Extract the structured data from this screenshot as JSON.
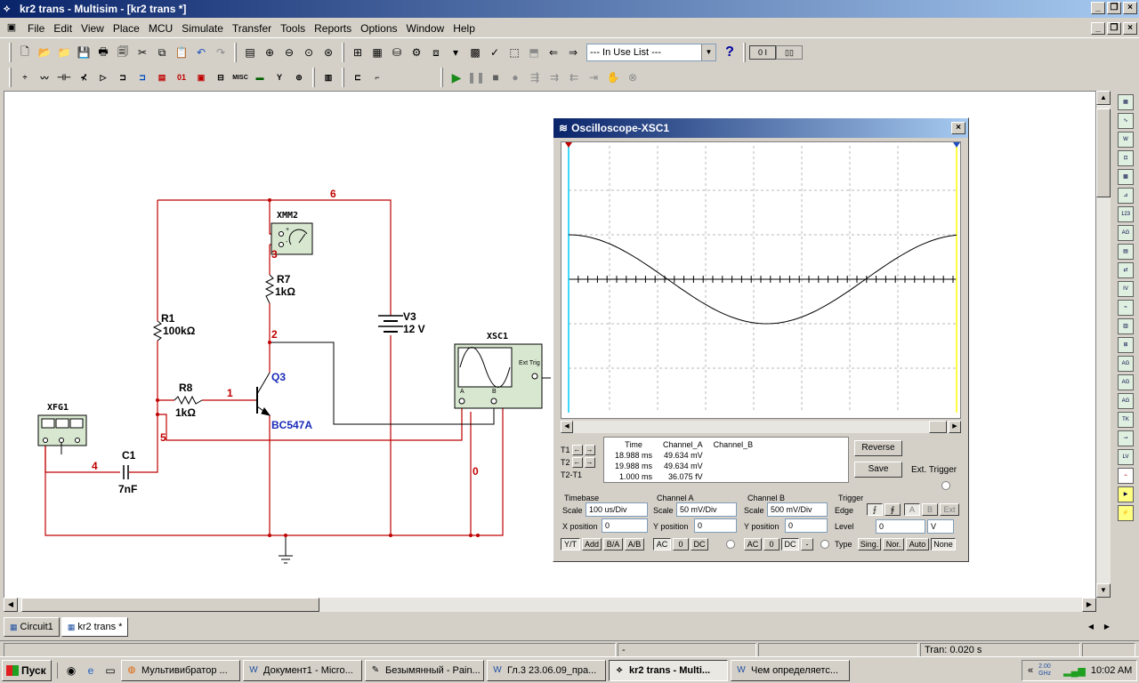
{
  "app": {
    "title": "kr2 trans - Multisim - [kr2 trans *]"
  },
  "menu": [
    "File",
    "Edit",
    "View",
    "Place",
    "MCU",
    "Simulate",
    "Transfer",
    "Tools",
    "Reports",
    "Options",
    "Window",
    "Help"
  ],
  "toolbar": {
    "in_use_list": "--- In Use List ---",
    "misc_label": "MISC"
  },
  "circuit": {
    "components": {
      "r1_name": "R1",
      "r1_value": "100kΩ",
      "r7_name": "R7",
      "r7_value": "1kΩ",
      "r8_name": "R8",
      "r8_value": "1kΩ",
      "c1_name": "C1",
      "c1_value": "7nF",
      "v3_name": "V3",
      "v3_value": "12 V",
      "q3_name": "Q3",
      "q3_model": "BC547A",
      "xmm2": "XMM2",
      "xfg1": "XFG1",
      "xsc1": "XSC1",
      "ext_trig": "Ext Trig",
      "xmm_plus": "+",
      "xmm_minus": "-",
      "xsc_a": "A",
      "xsc_b": "B"
    },
    "nets": [
      "6",
      "3",
      "2",
      "1",
      "5",
      "4",
      "0"
    ]
  },
  "oscilloscope": {
    "title": "Oscilloscope-XSC1",
    "labels": {
      "t1": "T1",
      "t2": "T2",
      "t21": "T2-T1"
    },
    "table": {
      "headers": [
        "Time",
        "Channel_A",
        "Channel_B"
      ],
      "rows": [
        [
          "18.988 ms",
          "49.634 mV",
          ""
        ],
        [
          "19.988 ms",
          "49.634 mV",
          ""
        ],
        [
          "1.000 ms",
          "36.075 fV",
          ""
        ]
      ]
    },
    "buttons": {
      "reverse": "Reverse",
      "save": "Save",
      "ext_trigger": "Ext. Trigger"
    },
    "timebase": {
      "title": "Timebase",
      "scale_label": "Scale",
      "scale": "100 us/Div",
      "xpos_label": "X position",
      "xpos": "0",
      "modes": [
        "Y/T",
        "Add",
        "B/A",
        "A/B"
      ]
    },
    "channel_a": {
      "title": "Channel A",
      "scale_label": "Scale",
      "scale": "50 mV/Div",
      "ypos_label": "Y position",
      "ypos": "0",
      "coupling": [
        "AC",
        "0",
        "DC"
      ]
    },
    "channel_b": {
      "title": "Channel B",
      "scale_label": "Scale",
      "scale": "500 mV/Div",
      "ypos_label": "Y position",
      "ypos": "0",
      "coupling": [
        "AC",
        "0",
        "DC",
        "-"
      ]
    },
    "trigger": {
      "title": "Trigger",
      "edge_label": "Edge",
      "edge_sources": [
        "A",
        "B",
        "Ext"
      ],
      "level_label": "Level",
      "level": "0",
      "level_unit": "V",
      "type_label": "Type",
      "types": [
        "Sing.",
        "Nor.",
        "Auto",
        "None"
      ]
    }
  },
  "tabs": [
    "Circuit1",
    "kr2 trans *"
  ],
  "status": {
    "transient": "Tran: 0.020 s",
    "dash": "-"
  },
  "taskbar": {
    "start": "Пуск",
    "tasks": [
      "Мультивибратор ...",
      "Документ1 - Micro...",
      "Безымянный - Pain...",
      "Гл.3 23.06.09_пра...",
      "kr2 trans - Multi...",
      "Чем определяетс..."
    ],
    "active_index": 4,
    "tray_arrow": "«",
    "cpu": "2.00 GHz",
    "clock": "10:02 AM"
  },
  "colors": {
    "wire": "#c00000",
    "net_label": "#c00000",
    "transistor_label": "#1a2ab8",
    "trace": "#000000",
    "cursor1": "#00ccff",
    "cursor2": "#ffff00"
  }
}
